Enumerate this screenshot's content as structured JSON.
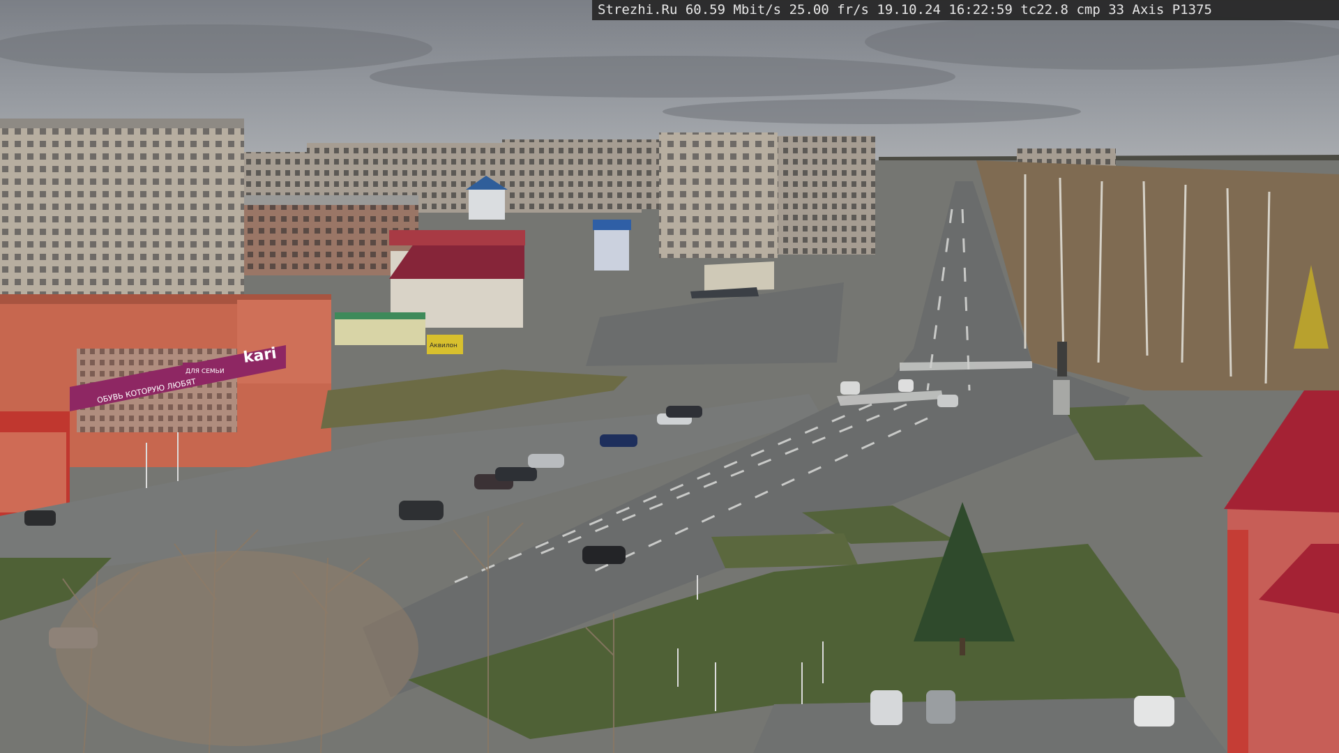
{
  "overlay": {
    "source": "Strezhi.Ru",
    "bitrate": "60.59 Mbit/s",
    "framerate": "25.00 fr/s",
    "date": "19.10.24",
    "time": "16:22:59",
    "tc": "tc22.8",
    "cmp": "cmp 33",
    "camera": "Axis P1375"
  },
  "signs": {
    "store_main": "kari",
    "store_banner": "ОБУВЬ КОТОРУЮ ЛЮБЯТ",
    "store_small": "ДЛЯ СЕМЬИ",
    "akvilon": "Аквилон"
  },
  "colors": {
    "sky": "#8c9096",
    "road": "#6d6f70",
    "grass": "#56663a",
    "kari_purple": "#8e2763",
    "brick": "#c7674f",
    "roof_red": "#a42234"
  }
}
